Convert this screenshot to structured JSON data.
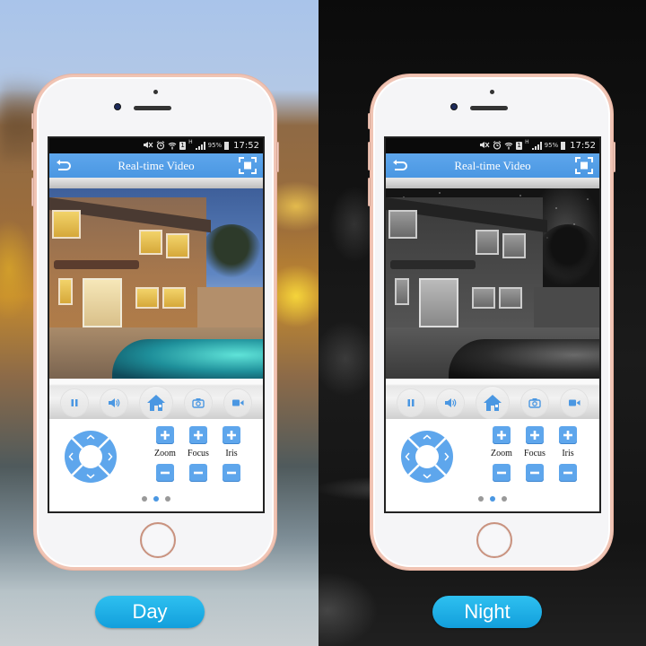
{
  "day_panel": {
    "mode_label": "Day",
    "status_bar": {
      "icons": [
        "mute-icon",
        "alarm-icon",
        "wifi-icon",
        "sim-icon",
        "network-type-icon",
        "signal-icon"
      ],
      "sim": "1",
      "network_type": "H",
      "battery": "95%",
      "time": "17:52"
    },
    "title_bar": {
      "back_icon": "back-arrow-icon",
      "title": "Real-time Video",
      "fullscreen_icon": "fullscreen-icon"
    },
    "video": {
      "scene": "house-with-pool-dusk-color"
    },
    "toolbar": {
      "buttons": [
        {
          "name": "pause",
          "icon": "pause-icon",
          "glyph": "❚❚"
        },
        {
          "name": "audio",
          "icon": "speaker-icon",
          "glyph": "🔊"
        },
        {
          "name": "home",
          "icon": "home-icon",
          "glyph": ""
        },
        {
          "name": "snapshot",
          "icon": "camera-icon",
          "glyph": ""
        },
        {
          "name": "record",
          "icon": "video-record-icon",
          "glyph": ""
        }
      ]
    },
    "ptz": {
      "dpad": [
        "up",
        "right",
        "down",
        "left"
      ],
      "controls": [
        {
          "label": "Zoom",
          "plus": "+",
          "minus": "−"
        },
        {
          "label": "Focus",
          "plus": "+",
          "minus": "−"
        },
        {
          "label": "Iris",
          "plus": "+",
          "minus": "−"
        }
      ]
    },
    "pagination": {
      "total": 3,
      "active": 2
    }
  },
  "night_panel": {
    "mode_label": "Night",
    "status_bar": {
      "icons": [
        "mute-icon",
        "alarm-icon",
        "wifi-icon",
        "sim-icon",
        "network-type-icon",
        "signal-icon"
      ],
      "sim": "1",
      "network_type": "H",
      "battery": "95%",
      "time": "17:52"
    },
    "title_bar": {
      "back_icon": "back-arrow-icon",
      "title": "Real-time Video",
      "fullscreen_icon": "fullscreen-icon"
    },
    "video": {
      "scene": "house-with-pool-night-infrared"
    },
    "toolbar": {
      "buttons": [
        {
          "name": "pause",
          "icon": "pause-icon",
          "glyph": "❚❚"
        },
        {
          "name": "audio",
          "icon": "speaker-icon",
          "glyph": "🔊"
        },
        {
          "name": "home",
          "icon": "home-icon",
          "glyph": ""
        },
        {
          "name": "snapshot",
          "icon": "camera-icon",
          "glyph": ""
        },
        {
          "name": "record",
          "icon": "video-record-icon",
          "glyph": ""
        }
      ]
    },
    "ptz": {
      "dpad": [
        "up",
        "right",
        "down",
        "left"
      ],
      "controls": [
        {
          "label": "Zoom",
          "plus": "+",
          "minus": "−"
        },
        {
          "label": "Focus",
          "plus": "+",
          "minus": "−"
        },
        {
          "label": "Iris",
          "plus": "+",
          "minus": "−"
        }
      ]
    },
    "pagination": {
      "total": 3,
      "active": 2
    }
  },
  "colors": {
    "accent_blue": "#4a97e2",
    "pill_blue": "#1eaee6",
    "phone_rose_gold": "#f0c4b4"
  }
}
